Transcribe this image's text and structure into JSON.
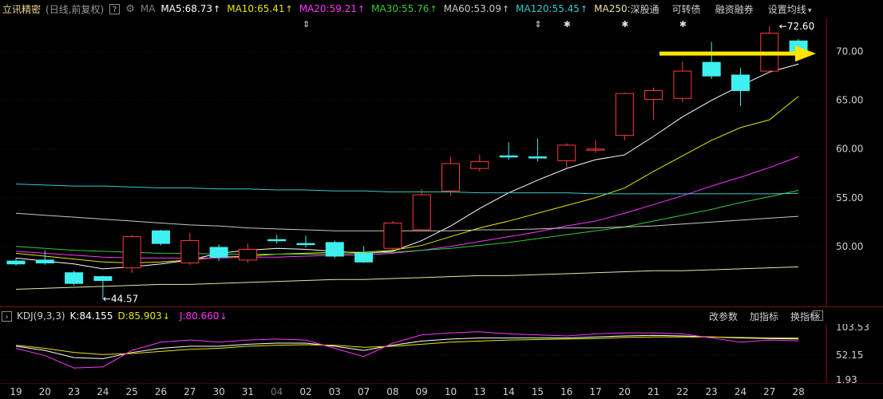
{
  "header": {
    "stock_name": "立讯精密",
    "period": "(日线,前复权)",
    "help_icon": "?",
    "ma_label": "MA",
    "ma_items": [
      {
        "label": "MA5:68.73",
        "color": "#ffffff"
      },
      {
        "label": "MA10:65.41",
        "color": "#e6e600"
      },
      {
        "label": "MA20:59.21",
        "color": "#ff33ff"
      },
      {
        "label": "MA30:55.76",
        "color": "#33cc33"
      },
      {
        "label": "MA60:53.09",
        "color": "#c8c8c8"
      },
      {
        "label": "MA120:55.45",
        "color": "#33cccc"
      },
      {
        "label": "MA250:",
        "color": "#e6e6a0"
      }
    ],
    "menu": [
      "深股通",
      "可转债",
      "融资融券",
      "设置均线"
    ],
    "dropdown_icon": "▾"
  },
  "price_axis": [
    "70.00",
    "65.00",
    "60.00",
    "55.00",
    "50.00"
  ],
  "annotations": {
    "high_label": "72.60",
    "low_label": "44.57"
  },
  "kdj": {
    "title": "KDJ(9,3,3)",
    "k_label": "K:84.155",
    "d_label": "D:85.903",
    "j_label": "J:80.660",
    "buttons": [
      "改参数",
      "加指标",
      "换指标"
    ],
    "axis": [
      "103.53",
      "52.15",
      "1.93"
    ]
  },
  "chart_data": {
    "type": "candlestick",
    "ylim": [
      44,
      73.5
    ],
    "dates": [
      "19",
      "20",
      "23",
      "24",
      "25",
      "26",
      "27",
      "30",
      "31",
      "04",
      "02",
      "03",
      "07",
      "08",
      "09",
      "10",
      "13",
      "14",
      "15",
      "16",
      "17",
      "20",
      "21",
      "22",
      "23",
      "24",
      "27",
      "28"
    ],
    "candles": [
      {
        "o": 48.5,
        "c": 48.2,
        "h": 48.8,
        "l": 48.0
      },
      {
        "o": 48.6,
        "c": 48.3,
        "h": 49.6,
        "l": 48.1
      },
      {
        "o": 47.3,
        "c": 46.2,
        "h": 47.5,
        "l": 46.0
      },
      {
        "o": 46.9,
        "c": 46.5,
        "h": 47.0,
        "l": 44.6
      },
      {
        "o": 47.8,
        "c": 51.0,
        "h": 51.2,
        "l": 47.3
      },
      {
        "o": 51.6,
        "c": 50.3,
        "h": 51.7,
        "l": 50.1
      },
      {
        "o": 48.3,
        "c": 50.6,
        "h": 51.4,
        "l": 48.1
      },
      {
        "o": 49.9,
        "c": 48.9,
        "h": 50.2,
        "l": 48.5
      },
      {
        "o": 48.6,
        "c": 49.7,
        "h": 50.3,
        "l": 48.3
      },
      {
        "o": 50.7,
        "c": 50.6,
        "h": 51.2,
        "l": 50.3
      },
      {
        "o": 50.3,
        "c": 50.2,
        "h": 51.1,
        "l": 49.9
      },
      {
        "o": 50.4,
        "c": 49.0,
        "h": 50.6,
        "l": 48.8
      },
      {
        "o": 49.3,
        "c": 48.4,
        "h": 50.0,
        "l": 48.3
      },
      {
        "o": 49.8,
        "c": 52.4,
        "h": 52.6,
        "l": 49.6
      },
      {
        "o": 51.7,
        "c": 55.3,
        "h": 55.9,
        "l": 51.6
      },
      {
        "o": 55.7,
        "c": 58.5,
        "h": 59.2,
        "l": 55.2
      },
      {
        "o": 58.0,
        "c": 58.7,
        "h": 59.4,
        "l": 57.7
      },
      {
        "o": 59.3,
        "c": 59.2,
        "h": 60.7,
        "l": 58.9
      },
      {
        "o": 59.2,
        "c": 59.1,
        "h": 61.1,
        "l": 58.7
      },
      {
        "o": 58.8,
        "c": 60.4,
        "h": 60.6,
        "l": 58.1
      },
      {
        "o": 60.0,
        "c": 60.0,
        "h": 60.9,
        "l": 59.6
      },
      {
        "o": 61.4,
        "c": 65.7,
        "h": 65.8,
        "l": 60.9
      },
      {
        "o": 65.1,
        "c": 66.0,
        "h": 66.3,
        "l": 63.0
      },
      {
        "o": 65.2,
        "c": 68.0,
        "h": 69.0,
        "l": 64.8
      },
      {
        "o": 68.9,
        "c": 67.5,
        "h": 71.0,
        "l": 67.2
      },
      {
        "o": 67.6,
        "c": 66.0,
        "h": 68.3,
        "l": 64.4
      },
      {
        "o": 68.0,
        "c": 71.9,
        "h": 72.6,
        "l": 67.8
      },
      {
        "o": 71.1,
        "c": 69.9,
        "h": 71.3,
        "l": 69.6
      }
    ],
    "ma_lines": [
      {
        "name": "MA5",
        "color": "#ffffff",
        "values": [
          48.8,
          48.5,
          48.2,
          47.7,
          47.9,
          48.2,
          48.6,
          49.3,
          49.6,
          49.8,
          49.7,
          49.5,
          49.3,
          49.5,
          50.6,
          52.1,
          53.9,
          55.5,
          56.8,
          58.0,
          58.9,
          59.4,
          61.3,
          63.3,
          65.0,
          66.5,
          67.9,
          68.73
        ]
      },
      {
        "name": "MA10",
        "color": "#e6e600",
        "values": [
          49.3,
          49.0,
          48.7,
          48.4,
          48.3,
          48.4,
          48.6,
          48.9,
          49.0,
          49.2,
          49.3,
          49.4,
          49.4,
          49.6,
          50.1,
          51.0,
          51.9,
          52.6,
          53.4,
          54.2,
          55.0,
          56.0,
          57.7,
          59.3,
          60.9,
          62.2,
          63.0,
          65.41
        ]
      },
      {
        "name": "MA20",
        "color": "#ff33ff",
        "values": [
          49.5,
          49.3,
          49.1,
          48.9,
          48.8,
          48.8,
          48.8,
          48.8,
          48.9,
          48.9,
          49.0,
          49.1,
          49.1,
          49.3,
          49.6,
          50.0,
          50.5,
          51.0,
          51.5,
          52.1,
          52.6,
          53.4,
          54.3,
          55.2,
          56.2,
          57.1,
          58.1,
          59.21
        ]
      },
      {
        "name": "MA30",
        "color": "#33cc33",
        "values": [
          50.0,
          49.8,
          49.6,
          49.5,
          49.4,
          49.3,
          49.3,
          49.2,
          49.2,
          49.2,
          49.2,
          49.2,
          49.3,
          49.4,
          49.6,
          49.8,
          50.1,
          50.4,
          50.8,
          51.2,
          51.6,
          52.0,
          52.6,
          53.2,
          53.8,
          54.5,
          55.1,
          55.76
        ]
      },
      {
        "name": "MA60",
        "color": "#c8c8c8",
        "values": [
          53.4,
          53.2,
          53.0,
          52.8,
          52.6,
          52.4,
          52.2,
          52.1,
          51.9,
          51.8,
          51.7,
          51.6,
          51.6,
          51.6,
          51.6,
          51.6,
          51.7,
          51.7,
          51.8,
          51.9,
          51.9,
          52.0,
          52.1,
          52.3,
          52.5,
          52.7,
          52.9,
          53.09
        ]
      },
      {
        "name": "MA120",
        "color": "#33cccc",
        "values": [
          56.4,
          56.3,
          56.2,
          56.2,
          56.1,
          56.0,
          56.0,
          55.9,
          55.9,
          55.8,
          55.8,
          55.7,
          55.7,
          55.6,
          55.6,
          55.6,
          55.5,
          55.5,
          55.5,
          55.5,
          55.4,
          55.4,
          55.4,
          55.4,
          55.4,
          55.4,
          55.4,
          55.45
        ]
      },
      {
        "name": "MA250",
        "color": "#e6e6a0",
        "values": [
          45.6,
          45.7,
          45.8,
          45.9,
          46.0,
          46.1,
          46.1,
          46.2,
          46.3,
          46.4,
          46.5,
          46.6,
          46.6,
          46.7,
          46.8,
          46.9,
          47.0,
          47.0,
          47.1,
          47.2,
          47.3,
          47.4,
          47.5,
          47.5,
          47.6,
          47.7,
          47.8,
          47.9
        ]
      }
    ],
    "kdj_ylim": [
      1.93,
      110
    ],
    "kdj_series": [
      {
        "name": "K",
        "color": "#ffffff",
        "values": [
          70,
          62,
          48,
          46,
          58,
          66,
          70,
          70,
          74,
          76,
          76,
          70,
          62,
          72,
          80,
          84,
          86,
          86,
          86,
          86,
          88,
          90,
          91,
          90,
          88,
          86,
          85,
          84.155
        ]
      },
      {
        "name": "D",
        "color": "#e6e600",
        "values": [
          72,
          66,
          58,
          54,
          56,
          60,
          64,
          66,
          70,
          72,
          73,
          72,
          68,
          70,
          74,
          78,
          80,
          82,
          83,
          84,
          85,
          87,
          88,
          88,
          88,
          87,
          86,
          85.903
        ]
      },
      {
        "name": "J",
        "color": "#ff33ff",
        "values": [
          66,
          52,
          28,
          30,
          62,
          78,
          82,
          78,
          82,
          84,
          82,
          66,
          50,
          76,
          92,
          96,
          98,
          94,
          92,
          90,
          94,
          96,
          96,
          94,
          86,
          78,
          82,
          80.66
        ]
      }
    ]
  }
}
